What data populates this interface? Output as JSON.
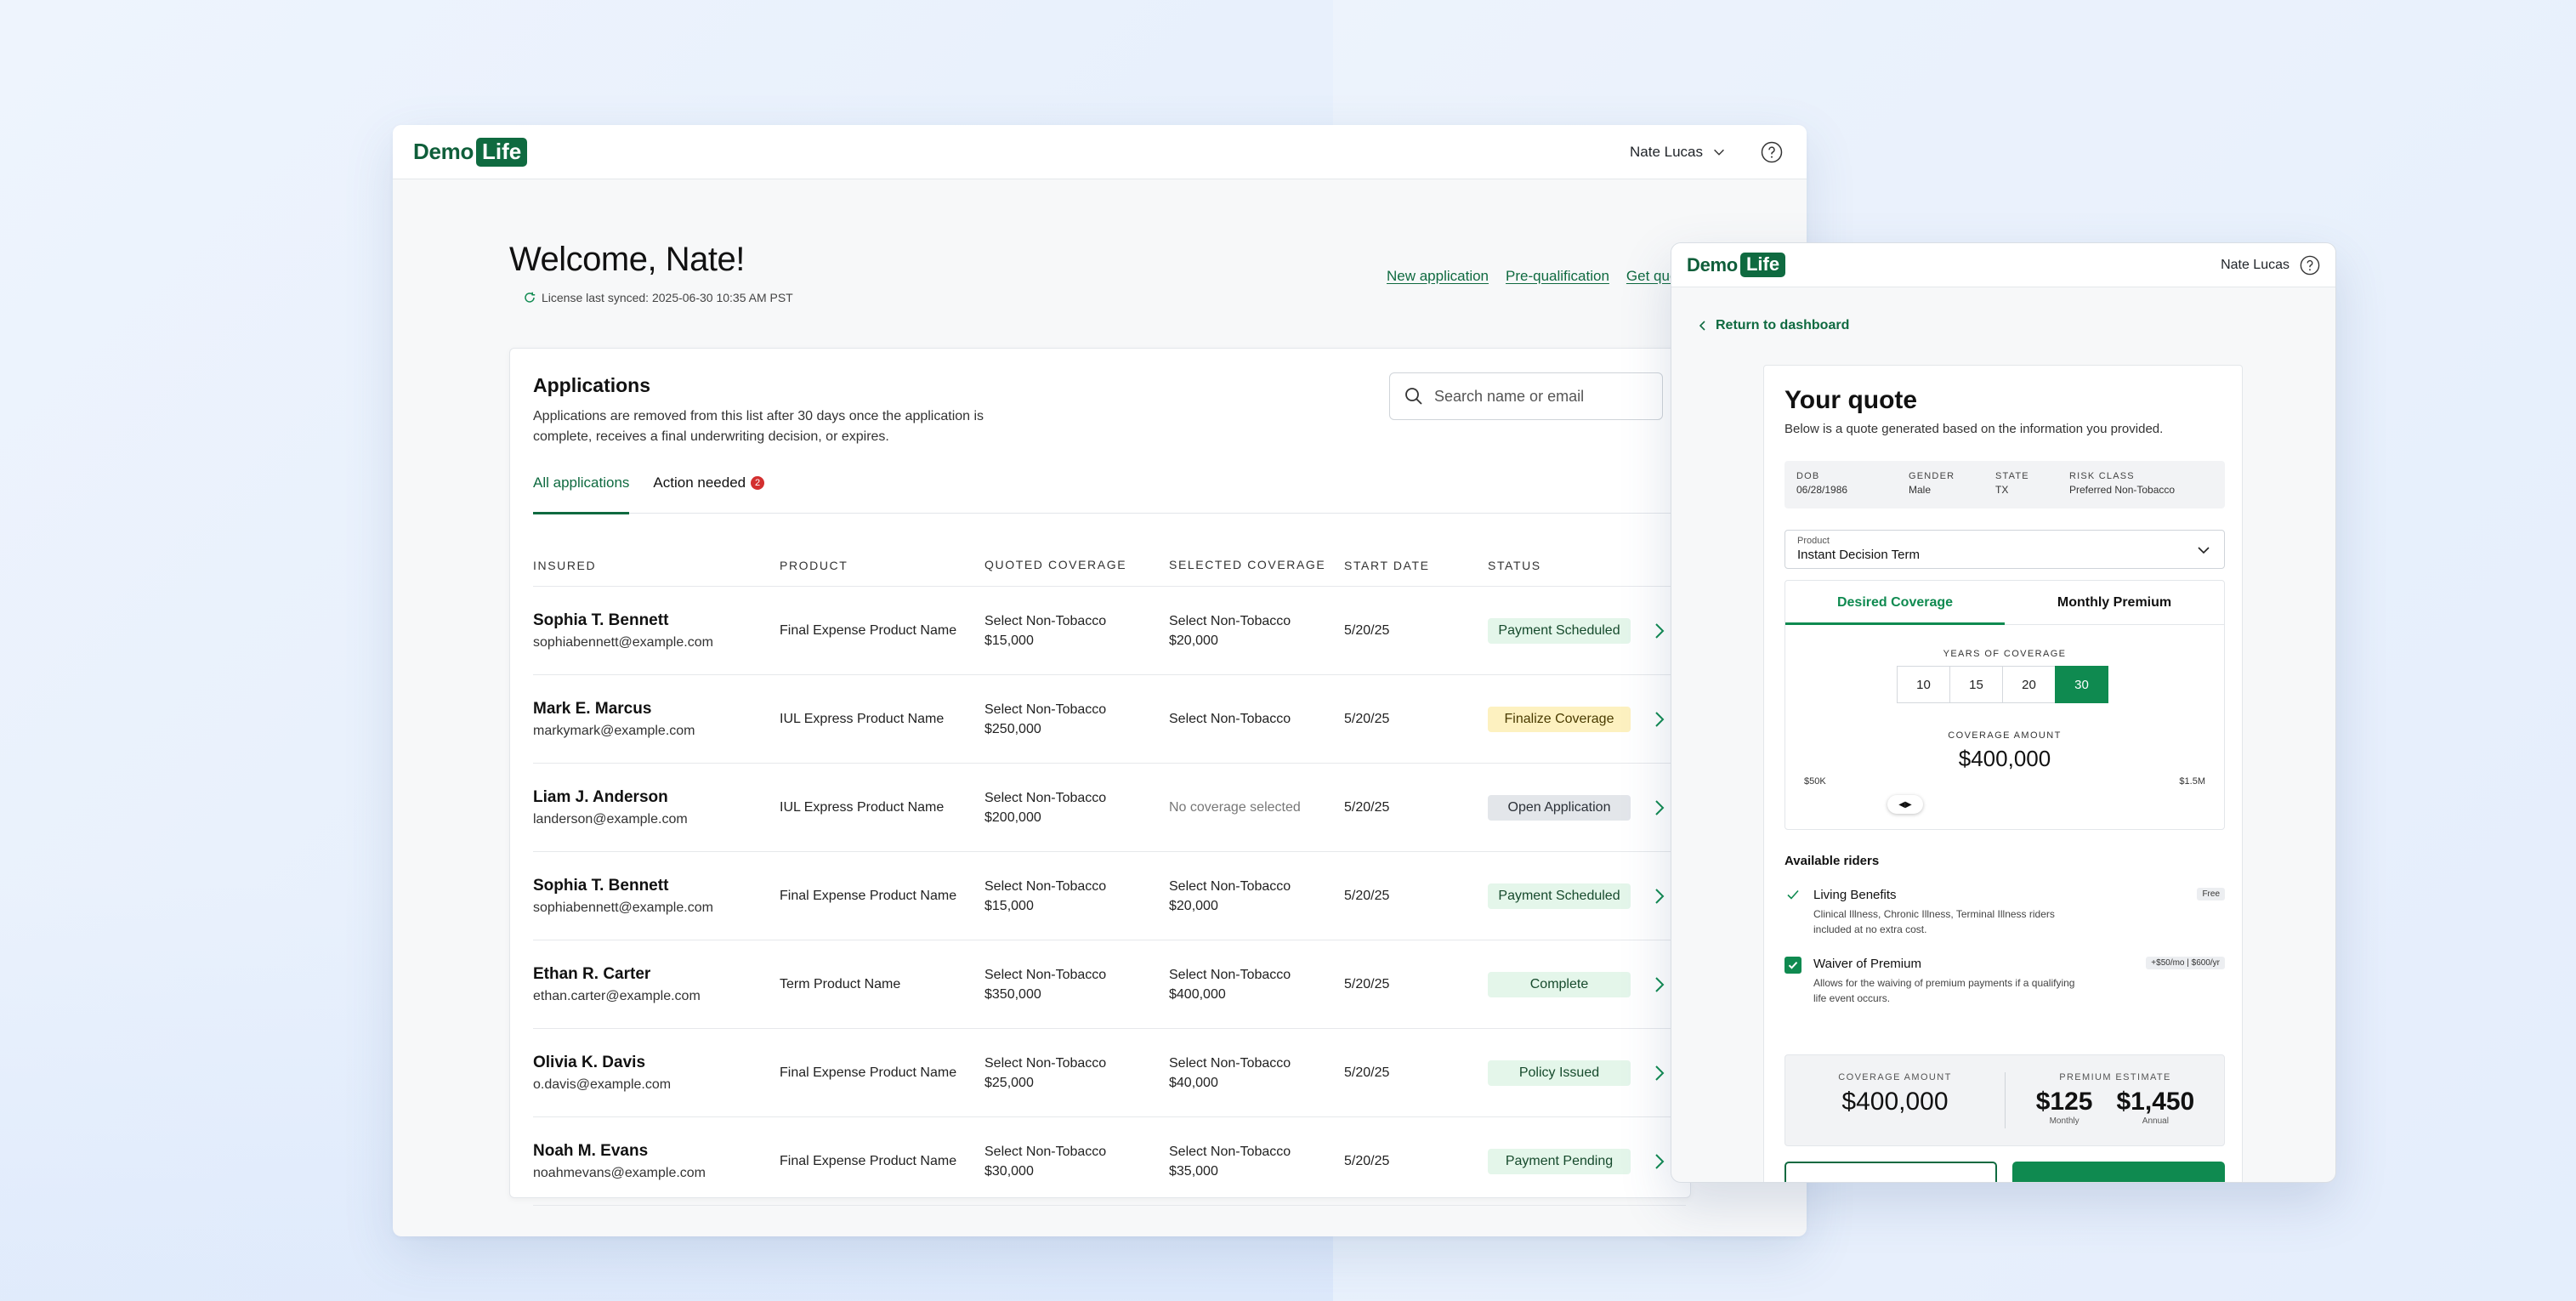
{
  "dashboard": {
    "logo": {
      "demo": "Demo",
      "life": "Life"
    },
    "user_name": "Nate Lucas",
    "welcome": "Welcome, Nate!",
    "sync_text": "License last synced: 2025-06-30 10:35 AM PST",
    "quick_links": [
      "New application",
      "Pre-qualification",
      "Get quote"
    ],
    "applications": {
      "title": "Applications",
      "description": "Applications are removed from this list after 30 days once the application is complete, receives a final underwriting decision, or expires.",
      "search_placeholder": "Search name or email",
      "tabs": [
        {
          "label": "All applications",
          "active": true
        },
        {
          "label": "Action needed",
          "badge": "2",
          "active": false
        }
      ],
      "columns": [
        "INSURED",
        "PRODUCT",
        "QUOTED COVERAGE",
        "SELECTED COVERAGE",
        "START DATE",
        "STATUS"
      ],
      "rows": [
        {
          "name": "Sophia T. Bennett",
          "email": "sophiabennett@example.com",
          "product": "Final Expense Product Name",
          "quoted_plan": "Select Non-Tobacco",
          "quoted_amount": "$15,000",
          "selected_plan": "Select Non-Tobacco",
          "selected_amount": "$20,000",
          "start_date": "5/20/25",
          "status": "Payment Scheduled",
          "status_color": "green"
        },
        {
          "name": "Mark E. Marcus",
          "email": "markymark@example.com",
          "product": "IUL Express Product Name",
          "quoted_plan": "Select Non-Tobacco",
          "quoted_amount": "$250,000",
          "selected_plan": "Select Non-Tobacco",
          "selected_amount": "",
          "start_date": "5/20/25",
          "status": "Finalize Coverage",
          "status_color": "yellow"
        },
        {
          "name": "Liam J. Anderson",
          "email": "landerson@example.com",
          "product": "IUL Express Product Name",
          "quoted_plan": "Select Non-Tobacco",
          "quoted_amount": "$200,000",
          "selected_plan": "No coverage selected",
          "selected_amount": "",
          "start_date": "5/20/25",
          "status": "Open Application",
          "status_color": "gray"
        },
        {
          "name": "Sophia T. Bennett",
          "email": "sophiabennett@example.com",
          "product": "Final Expense Product Name",
          "quoted_plan": "Select Non-Tobacco",
          "quoted_amount": "$15,000",
          "selected_plan": "Select Non-Tobacco",
          "selected_amount": "$20,000",
          "start_date": "5/20/25",
          "status": "Payment Scheduled",
          "status_color": "green"
        },
        {
          "name": "Ethan R. Carter",
          "email": "ethan.carter@example.com",
          "product": "Term Product Name",
          "quoted_plan": "Select Non-Tobacco",
          "quoted_amount": "$350,000",
          "selected_plan": "Select Non-Tobacco",
          "selected_amount": "$400,000",
          "start_date": "5/20/25",
          "status": "Complete",
          "status_color": "green"
        },
        {
          "name": "Olivia K. Davis",
          "email": "o.davis@example.com",
          "product": "Final Expense Product Name",
          "quoted_plan": "Select Non-Tobacco",
          "quoted_amount": "$25,000",
          "selected_plan": "Select Non-Tobacco",
          "selected_amount": "$40,000",
          "start_date": "5/20/25",
          "status": "Policy Issued",
          "status_color": "green"
        },
        {
          "name": "Noah M. Evans",
          "email": "noahmevans@example.com",
          "product": "Final Expense Product Name",
          "quoted_plan": "Select Non-Tobacco",
          "quoted_amount": "$30,000",
          "selected_plan": "Select Non-Tobacco",
          "selected_amount": "$35,000",
          "start_date": "5/20/25",
          "status": "Payment Pending",
          "status_color": "green"
        }
      ]
    }
  },
  "quote": {
    "logo": {
      "demo": "Demo",
      "life": "Life"
    },
    "user_name": "Nate Lucas",
    "back_link": "Return to dashboard",
    "title": "Your quote",
    "subtitle": "Below is a quote generated based on the information you provided.",
    "info": [
      {
        "key": "DOB",
        "value": "06/28/1986"
      },
      {
        "key": "GENDER",
        "value": "Male"
      },
      {
        "key": "STATE",
        "value": "TX"
      },
      {
        "key": "RISK CLASS",
        "value": "Preferred Non-Tobacco"
      }
    ],
    "product_label": "Product",
    "product_value": "Instant Decision Term",
    "tabs": [
      {
        "label": "Desired Coverage",
        "active": true
      },
      {
        "label": "Monthly Premium",
        "active": false
      }
    ],
    "years_label": "YEARS OF COVERAGE",
    "years_options": [
      "10",
      "15",
      "20",
      "30"
    ],
    "years_selected": "30",
    "coverage_label": "COVERAGE AMOUNT",
    "coverage_value": "$400,000",
    "slider_min": "$50K",
    "slider_max": "$1.5M",
    "slider_handle": "◀▶",
    "riders_title": "Available riders",
    "riders": [
      {
        "name": "Living Benefits",
        "description": "Clinical Illness, Chronic Illness, Terminal Illness riders included at no extra cost.",
        "tag": "Free",
        "checked": true
      },
      {
        "name": "Waiver of Premium",
        "description": "Allows for the waiving of premium payments if a qualifying life event occurs.",
        "tag": "+$50/mo | $600/yr",
        "checked": true
      }
    ],
    "summary": {
      "coverage_label": "COVERAGE AMOUNT",
      "coverage_value": "$400,000",
      "premium_label": "PREMIUM ESTIMATE",
      "monthly_value": "$125",
      "monthly_label": "Monthly",
      "annual_value": "$1,450",
      "annual_label": "Annual"
    }
  },
  "colors": {
    "brand_green": "#0f6a40",
    "accent_green": "#0f8a50",
    "status_green_bg": "#e4f6ea",
    "status_yellow_bg": "#fdf1c0",
    "status_gray_bg": "#e3e6ea",
    "badge_red": "#d32f2f"
  }
}
